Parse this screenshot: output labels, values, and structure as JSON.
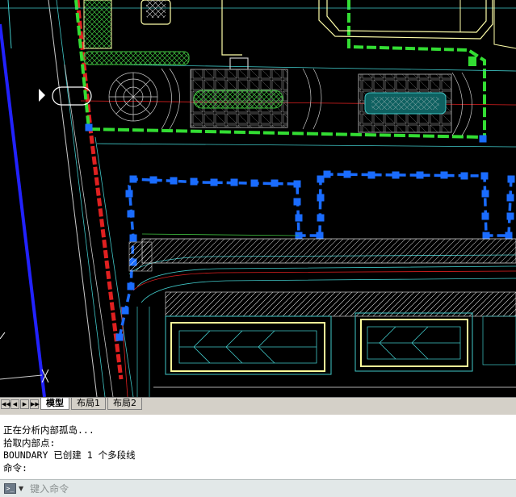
{
  "layout_tabs": [
    "模型",
    "布局1",
    "布局2"
  ],
  "active_tab": 0,
  "nav_buttons": [
    "◀◀",
    "◀",
    "▶",
    "▶▶"
  ],
  "command_history": [
    "正在分析内部孤岛...",
    "拾取内部点:",
    "BOUNDARY 已创建 1 个多段线",
    "命令:"
  ],
  "command_input": {
    "placeholder": "键入命令",
    "icon": "command-line-icon",
    "dropdown_icon": "chevron-down-icon"
  },
  "colors": {
    "canvas": "#000000",
    "boundary": "#1a6cff",
    "selection_grip": "#1a6cff",
    "road_red": "#e02020",
    "green_line": "#33dd33",
    "blue_line": "#2222ff",
    "cyan_line": "#40c8c8",
    "yellow_line": "#ffff99",
    "hatch_green": "#40c040"
  }
}
